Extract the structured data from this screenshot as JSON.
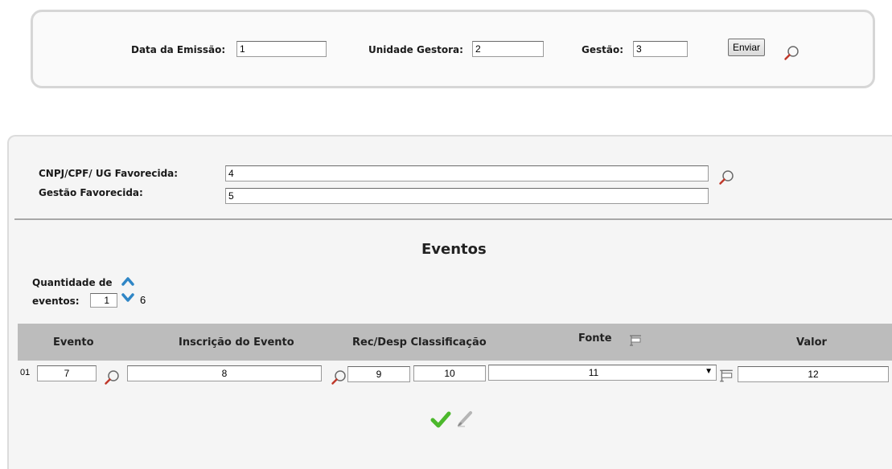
{
  "header_form": {
    "data_emissao_label": "Data da Emissão:",
    "data_emissao_value": "1",
    "unidade_gestora_label": "Unidade Gestora:",
    "unidade_gestora_value": "2",
    "gestao_label": "Gestão:",
    "gestao_value": "3",
    "enviar_label": "Enviar"
  },
  "favorecido": {
    "cnpj_label": "CNPJ/CPF/ UG Favorecida:",
    "cnpj_value": "4",
    "gestao_label": "Gestão Favorecida:",
    "gestao_value": "5"
  },
  "eventos": {
    "title": "Eventos",
    "quantidade_label_1": "Quantidade de",
    "quantidade_label_2": "eventos:",
    "quantidade_value": "1",
    "quantidade_annotation": "6",
    "columns": {
      "evento": "Evento",
      "inscricao": "Inscrição do Evento",
      "rec_desp": "Rec/Desp Classificação",
      "fonte": "Fonte",
      "valor": "Valor"
    },
    "rows": [
      {
        "index": "01",
        "evento": "7",
        "inscricao": "8",
        "rec_desp": "9",
        "classificacao": "10",
        "fonte": "11",
        "valor": "12"
      }
    ]
  },
  "colors": {
    "accent_blue": "#2f86c6",
    "check_green": "#4cb82c",
    "header_gray": "#bcbcbc"
  }
}
